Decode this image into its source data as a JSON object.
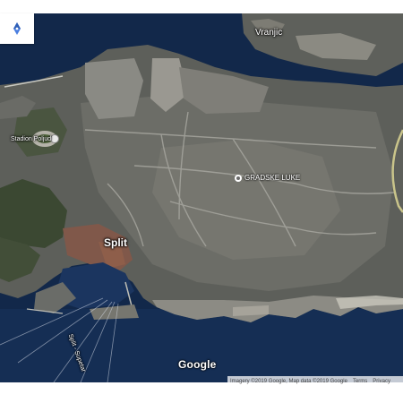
{
  "map": {
    "type": "satellite",
    "colors": {
      "sea": "#12284a",
      "land": "#5a5c58",
      "urban": "#77776f",
      "vegetation": "#3d4a34",
      "roofs": "#8a5a48"
    },
    "labels": {
      "vranjic": "Vranjic",
      "stadium": "Stadion Poljud",
      "split": "Split",
      "poi": "GRADSKE LUKE",
      "ferry_route": "Split - Supetar"
    }
  },
  "controls": {
    "compass_icon": "compass-icon",
    "logo": "Google"
  },
  "attribution": {
    "text": "Imagery ©2019 Google, Map data ©2019 Google",
    "terms": "Terms",
    "privacy": "Privacy"
  }
}
